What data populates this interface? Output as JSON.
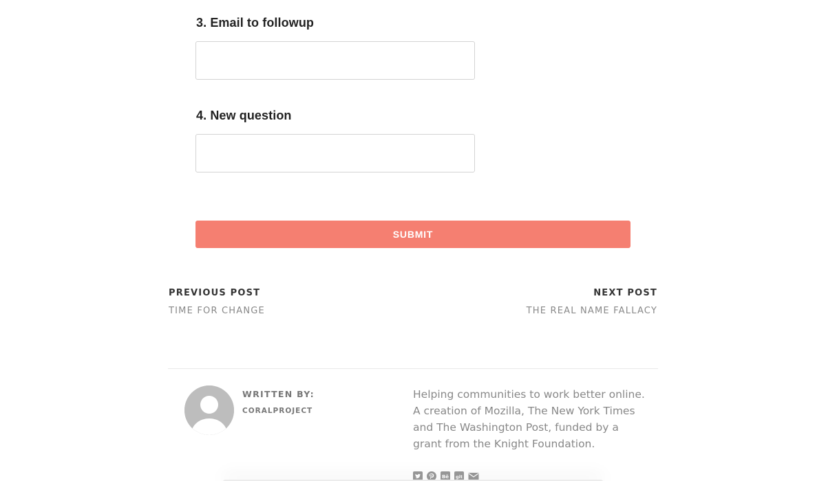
{
  "form": {
    "questions": [
      {
        "label": "3. Email to followup",
        "value": ""
      },
      {
        "label": "4. New question",
        "value": ""
      }
    ],
    "submit_label": "SUBMIT",
    "accent_color": "#f57f71"
  },
  "post_nav": {
    "previous": {
      "heading": "PREVIOUS POST",
      "title": "TIME FOR CHANGE"
    },
    "next": {
      "heading": "NEXT POST",
      "title": "THE REAL NAME FALLACY"
    }
  },
  "author": {
    "written_by_label": "WRITTEN BY:",
    "name": "CORALPROJECT",
    "bio": "Helping communities to work better online. A creation of Mozilla, The New York Times and The Washington Post, funded by a grant from the Knight Foundation."
  },
  "social_icons": [
    "twitter-icon",
    "pinterest-icon",
    "behance-icon",
    "git-icon",
    "email-icon"
  ]
}
